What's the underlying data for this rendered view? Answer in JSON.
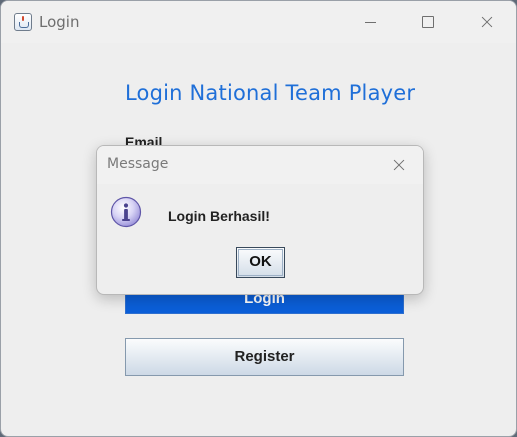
{
  "window": {
    "title": "Login",
    "controls": [
      "minimize-icon",
      "maximize-icon",
      "close-icon"
    ]
  },
  "form": {
    "heading": "Login National Team Player",
    "email_label": "Email",
    "login_label": "Login",
    "register_label": "Register"
  },
  "dialog": {
    "title": "Message",
    "message": "Login Berhasil!",
    "ok_label": "OK",
    "icon": "info-icon"
  },
  "colors": {
    "heading": "#1f6fd8",
    "login_button": "#0b5fd9",
    "register_button": "#dbe4ee"
  }
}
